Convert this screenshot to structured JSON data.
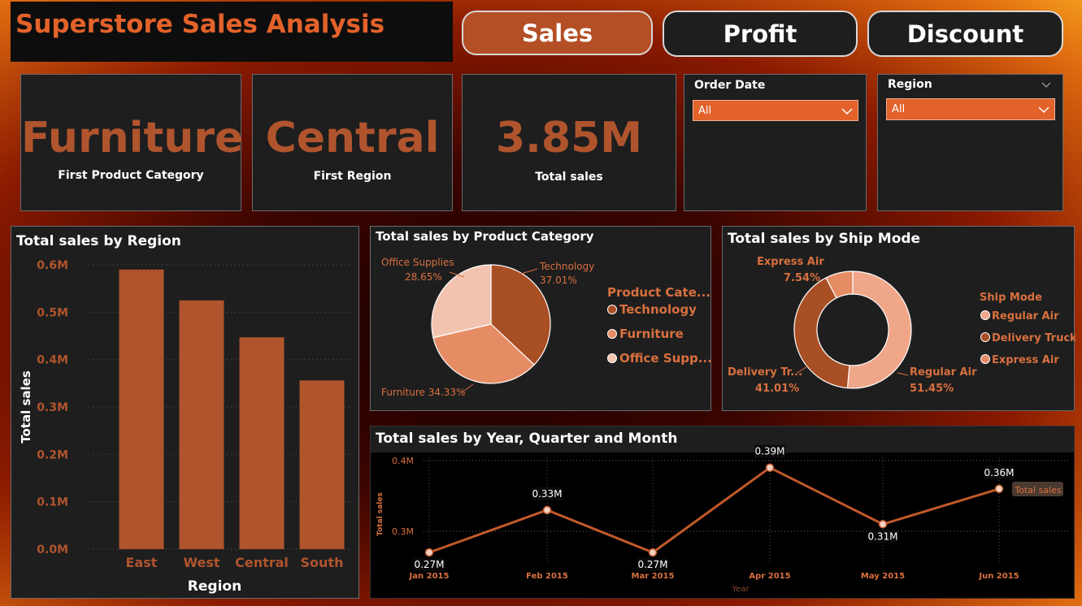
{
  "header": {
    "title": "Superstore Sales Analysis"
  },
  "nav": {
    "sales": "Sales",
    "profit": "Profit",
    "discount": "Discount"
  },
  "kpis": {
    "category_value": "Furniture",
    "category_label": "First Product Category",
    "region_value": "Central",
    "region_label": "First Region",
    "sales_value": "3.85M",
    "sales_label": "Total sales"
  },
  "slicers": {
    "order_date": {
      "title": "Order Date",
      "value": "All"
    },
    "region": {
      "title": "Region",
      "value": "All"
    }
  },
  "colors": {
    "accent": "#e2622a",
    "bar": "#b0542d",
    "dark": "#1e1e1e"
  },
  "charts": {
    "region": {
      "title": "Total sales by Region"
    },
    "category": {
      "title": "Total sales by Product Category"
    },
    "ship": {
      "title": "Total sales by Ship Mode"
    },
    "trend": {
      "title": "Total sales by Year, Quarter and Month"
    }
  },
  "chart_data": [
    {
      "type": "bar",
      "title": "Total sales by Region",
      "xlabel": "Region",
      "ylabel": "Total sales",
      "categories": [
        "East",
        "West",
        "Central",
        "South"
      ],
      "values": [
        0.59,
        0.525,
        0.447,
        0.356
      ],
      "ylim": [
        0,
        0.6
      ],
      "yticks": [
        "0.0M",
        "0.1M",
        "0.2M",
        "0.3M",
        "0.4M",
        "0.5M",
        "0.6M"
      ],
      "grid": true
    },
    {
      "type": "pie",
      "title": "Total sales by Product Category",
      "legend_title": "Product Cate...",
      "slices": [
        {
          "name": "Technology",
          "legend": "Technology",
          "value": 37.01,
          "label": "37.01%",
          "color": "#a94f25"
        },
        {
          "name": "Furniture",
          "legend": "Furniture",
          "value": 34.33,
          "label": "Furniture 34.33%",
          "color": "#e58c64"
        },
        {
          "name": "Office Supplies",
          "legend": "Office Supp...",
          "value": 28.65,
          "label": "28.65%",
          "color": "#f2c3ae"
        }
      ]
    },
    {
      "type": "pie",
      "subtype": "donut",
      "title": "Total sales by Ship Mode",
      "legend_title": "Ship Mode",
      "slices": [
        {
          "name": "Regular Air",
          "legend": "Regular Air",
          "value": 51.45,
          "label": "51.45%",
          "color": "#f0a688"
        },
        {
          "name": "Delivery Tr...",
          "legend": "Delivery Truck",
          "value": 41.01,
          "label": "41.01%",
          "color": "#a94f25"
        },
        {
          "name": "Express Air",
          "legend": "Express Air",
          "value": 7.54,
          "label": "7.54%",
          "color": "#e58c64"
        }
      ]
    },
    {
      "type": "line",
      "title": "Total sales by Year, Quarter and Month",
      "xlabel": "Year",
      "ylabel": "Total sales",
      "legend": "Total sales",
      "categories": [
        "Jan 2015",
        "Feb 2015",
        "Mar 2015",
        "Apr 2015",
        "May 2015",
        "Jun 2015"
      ],
      "values": [
        0.27,
        0.33,
        0.27,
        0.39,
        0.31,
        0.36
      ],
      "labels": [
        "0.27M",
        "0.33M",
        "0.27M",
        "0.39M",
        "0.31M",
        "0.36M"
      ],
      "ylim": [
        0.2,
        0.4
      ],
      "yticks": [
        "0.3M",
        "0.4M"
      ],
      "grid": true
    }
  ]
}
